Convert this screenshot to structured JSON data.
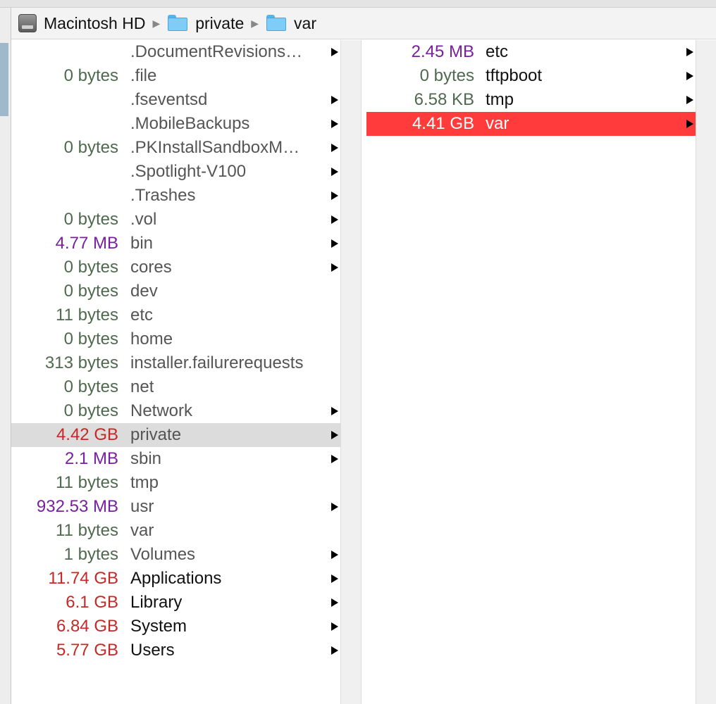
{
  "breadcrumb": {
    "items": [
      {
        "label": "Macintosh HD",
        "icon": "hard-drive-icon"
      },
      {
        "label": "private",
        "icon": "folder-icon"
      },
      {
        "label": "var",
        "icon": "folder-icon"
      }
    ],
    "separator": "▶"
  },
  "columns": [
    {
      "rows": [
        {
          "size": "",
          "name": ".DocumentRevisions…",
          "arrow": true,
          "sizeClass": "c-bytes",
          "nameClass": "n-dim"
        },
        {
          "size": "0 bytes",
          "name": ".file",
          "arrow": false,
          "sizeClass": "c-bytes",
          "nameClass": "n-dim"
        },
        {
          "size": "",
          "name": ".fseventsd",
          "arrow": true,
          "sizeClass": "c-bytes",
          "nameClass": "n-dim"
        },
        {
          "size": "",
          "name": ".MobileBackups",
          "arrow": true,
          "sizeClass": "c-bytes",
          "nameClass": "n-dim"
        },
        {
          "size": "0 bytes",
          "name": ".PKInstallSandboxM…",
          "arrow": true,
          "sizeClass": "c-bytes",
          "nameClass": "n-dim"
        },
        {
          "size": "",
          "name": ".Spotlight-V100",
          "arrow": true,
          "sizeClass": "c-bytes",
          "nameClass": "n-dim"
        },
        {
          "size": "",
          "name": ".Trashes",
          "arrow": true,
          "sizeClass": "c-bytes",
          "nameClass": "n-dim"
        },
        {
          "size": "0 bytes",
          "name": ".vol",
          "arrow": true,
          "sizeClass": "c-bytes",
          "nameClass": "n-dim"
        },
        {
          "size": "4.77 MB",
          "name": "bin",
          "arrow": true,
          "sizeClass": "c-mb",
          "nameClass": "n-dim"
        },
        {
          "size": "0 bytes",
          "name": "cores",
          "arrow": true,
          "sizeClass": "c-bytes",
          "nameClass": "n-dim"
        },
        {
          "size": "0 bytes",
          "name": "dev",
          "arrow": false,
          "sizeClass": "c-bytes",
          "nameClass": "n-dim"
        },
        {
          "size": "11 bytes",
          "name": "etc",
          "arrow": false,
          "sizeClass": "c-bytes",
          "nameClass": "n-dim"
        },
        {
          "size": "0 bytes",
          "name": "home",
          "arrow": false,
          "sizeClass": "c-bytes",
          "nameClass": "n-dim"
        },
        {
          "size": "313 bytes",
          "name": "installer.failurerequests",
          "arrow": false,
          "sizeClass": "c-bytes",
          "nameClass": "n-dim"
        },
        {
          "size": "0 bytes",
          "name": "net",
          "arrow": false,
          "sizeClass": "c-bytes",
          "nameClass": "n-dim"
        },
        {
          "size": "0 bytes",
          "name": "Network",
          "arrow": true,
          "sizeClass": "c-bytes",
          "nameClass": "n-dim"
        },
        {
          "size": "4.42 GB",
          "name": "private",
          "arrow": true,
          "sizeClass": "c-gb",
          "nameClass": "n-dim",
          "selected": "gray"
        },
        {
          "size": "2.1 MB",
          "name": "sbin",
          "arrow": true,
          "sizeClass": "c-mb",
          "nameClass": "n-dim"
        },
        {
          "size": "11 bytes",
          "name": "tmp",
          "arrow": false,
          "sizeClass": "c-bytes",
          "nameClass": "n-dim"
        },
        {
          "size": "932.53 MB",
          "name": "usr",
          "arrow": true,
          "sizeClass": "c-mb",
          "nameClass": "n-dim"
        },
        {
          "size": "11 bytes",
          "name": "var",
          "arrow": false,
          "sizeClass": "c-bytes",
          "nameClass": "n-dim"
        },
        {
          "size": "1 bytes",
          "name": "Volumes",
          "arrow": true,
          "sizeClass": "c-bytes",
          "nameClass": "n-dim"
        },
        {
          "size": "11.74 GB",
          "name": "Applications",
          "arrow": true,
          "sizeClass": "c-gb",
          "nameClass": "n-dark"
        },
        {
          "size": "6.1 GB",
          "name": "Library",
          "arrow": true,
          "sizeClass": "c-gb",
          "nameClass": "n-dark"
        },
        {
          "size": "6.84 GB",
          "name": "System",
          "arrow": true,
          "sizeClass": "c-gb",
          "nameClass": "n-dark"
        },
        {
          "size": "5.77 GB",
          "name": "Users",
          "arrow": true,
          "sizeClass": "c-gb",
          "nameClass": "n-dark"
        }
      ]
    },
    {
      "rows": [
        {
          "size": "2.45 MB",
          "name": "etc",
          "arrow": true,
          "sizeClass": "c-mb",
          "nameClass": "n-dark"
        },
        {
          "size": "0 bytes",
          "name": "tftpboot",
          "arrow": true,
          "sizeClass": "c-bytes",
          "nameClass": "n-dark"
        },
        {
          "size": "6.58 KB",
          "name": "tmp",
          "arrow": true,
          "sizeClass": "c-kb",
          "nameClass": "n-dark"
        },
        {
          "size": "4.41 GB",
          "name": "var",
          "arrow": true,
          "sizeClass": "c-gb",
          "nameClass": "n-dark",
          "selected": "red"
        }
      ]
    }
  ]
}
